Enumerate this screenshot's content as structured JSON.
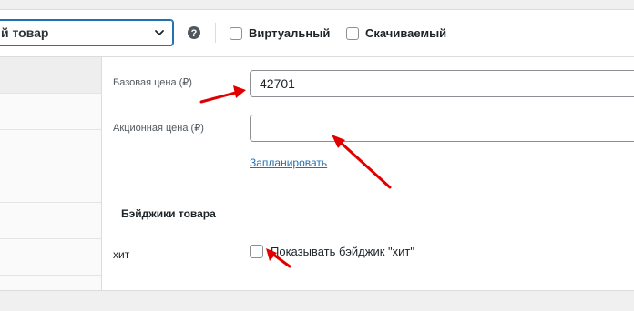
{
  "toolbar": {
    "product_type_value": "й товар",
    "virtual_label": "Виртуальный",
    "downloadable_label": "Скачиваемый"
  },
  "pricing": {
    "regular_price_label": "Базовая цена (₽)",
    "regular_price_value": "42701",
    "sale_price_label": "Акционная цена (₽)",
    "sale_price_value": "",
    "schedule_link": "Запланировать"
  },
  "badges": {
    "section_title": "Бэйджики товара",
    "hit_label": "хит",
    "hit_checkbox_label": "Показывать бэйджик \"хит\""
  },
  "colors": {
    "accent": "#2271b1",
    "arrow": "#e00000"
  },
  "icons": [
    "chevron-down-icon",
    "help-icon"
  ]
}
